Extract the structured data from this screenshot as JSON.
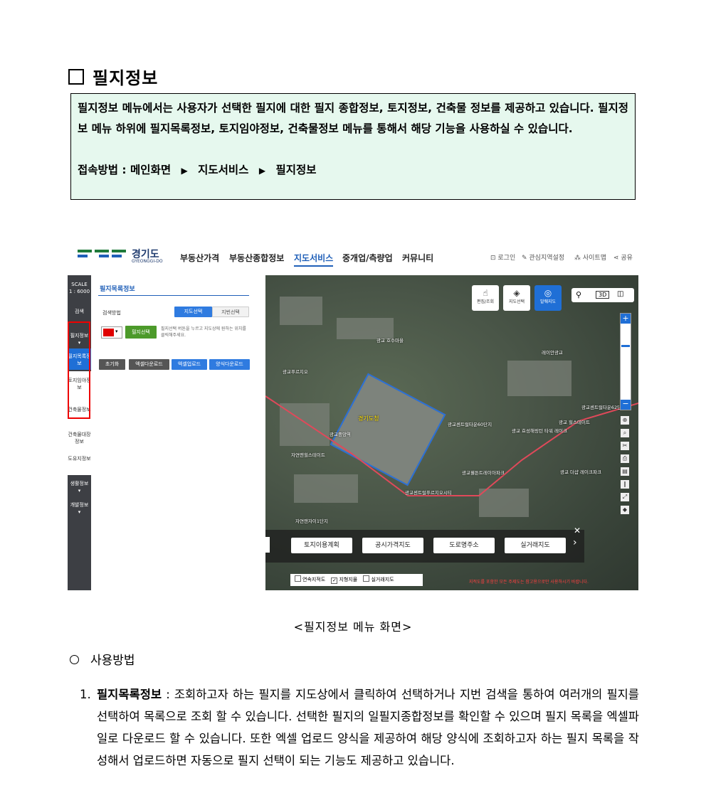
{
  "section": {
    "title": "필지정보"
  },
  "summary": {
    "text": "필지정보 메뉴에서는 사용자가 선택한 필지에 대한 필지 종합정보, 토지정보, 건축물 정보를 제공하고 있습니다. 필지정보 메뉴 하위에 필지목록정보, 토지임야정보, 건축물정보 메뉴를 통해서 해당 기능을 사용하실 수 있습니다.",
    "access_label": "접속방법 :",
    "path": [
      "메인화면",
      "지도서비스",
      "필지정보"
    ]
  },
  "screenshot": {
    "logo": {
      "name": "경기도",
      "sub": "GYEONGGI-DO"
    },
    "nav": [
      "부동산가격",
      "부동산종합정보",
      "지도서비스",
      "중개업/측량업",
      "커뮤니티"
    ],
    "active_nav": "지도서비스",
    "util": [
      "로그인",
      "관심지역설정",
      "사이트맵",
      "공유"
    ],
    "sidebar": {
      "scale_label": "SCALE",
      "scale_value": "1 : 6000",
      "items": [
        "검색",
        "필지정보",
        "필지목록정보",
        "토지임야정보",
        "건축물정보",
        "건축물대장정보",
        "도유지정보",
        "생활정보",
        "개발정보"
      ]
    },
    "panel": {
      "title": "필지목록정보",
      "search_method_label": "검색방법",
      "tabs": [
        "지도선택",
        "지번선택"
      ],
      "select_button": "필지선택",
      "hint": "필지선택 버튼을 누르고 지도상에 원하는 위치를 클릭해주세요.",
      "buttons": [
        "초기화",
        "엑셀다운로드",
        "엑셀업로드",
        "양식다운로드"
      ],
      "colors": {
        "blue": "#2f7be0",
        "green": "#4c9a2a",
        "dark": "#555555",
        "red": "#e00000"
      }
    },
    "map": {
      "controls": [
        "편집/조회",
        "지도선택",
        "발췌지도"
      ],
      "view_buttons": [
        "3D"
      ],
      "labels": [
        "광교센트럴타운60단지",
        "경기도청",
        "광교 호수마을",
        "광교중앙역",
        "광교푸르지오",
        "광교 힐스테이트",
        "레이안광교",
        "자연앤힐스테이트",
        "광교센트럴타운62단지",
        "광교 효성해링턴 타워 레이크",
        "광교 더샵 레이크파크",
        "광교웰튼트레이아파크",
        "광교센트럴푸르지오시티",
        "자연앤자이1단지"
      ],
      "layer_buttons": [
        "토지이용계획",
        "공시가격지도",
        "도로명주소",
        "실거래지도"
      ],
      "checkboxes": [
        {
          "label": "연속지적도",
          "checked": false
        },
        {
          "label": "지형지물",
          "checked": true
        },
        {
          "label": "실거래지도",
          "checked": false
        }
      ],
      "notice": "지적도를 포함한 모든 주제도는 참고용으로만 사용하시기 바랍니다."
    }
  },
  "caption": "<필지정보 메뉴 화면>",
  "usage": {
    "title": "사용방법",
    "items": [
      {
        "number": "1.",
        "term": "필지목록정보",
        "separator": " : ",
        "text": "조회하고자 하는 필지를 지도상에서 클릭하여 선택하거나 지번 검색을 통하여 여러개의 필지를 선택하여 목록으로 조회 할 수 있습니다. 선택한 필지의 일필지종합정보를 확인할 수 있으며 필지 목록을 엑셀파일로 다운로드 할 수 있습니다. 또한 엑셀 업로드 양식을 제공하여 해당 양식에 조회하고자 하는 필지 목록을 작성해서 업로드하면 자동으로 필지 선택이 되는 기능도 제공하고 있습니다."
      }
    ]
  }
}
